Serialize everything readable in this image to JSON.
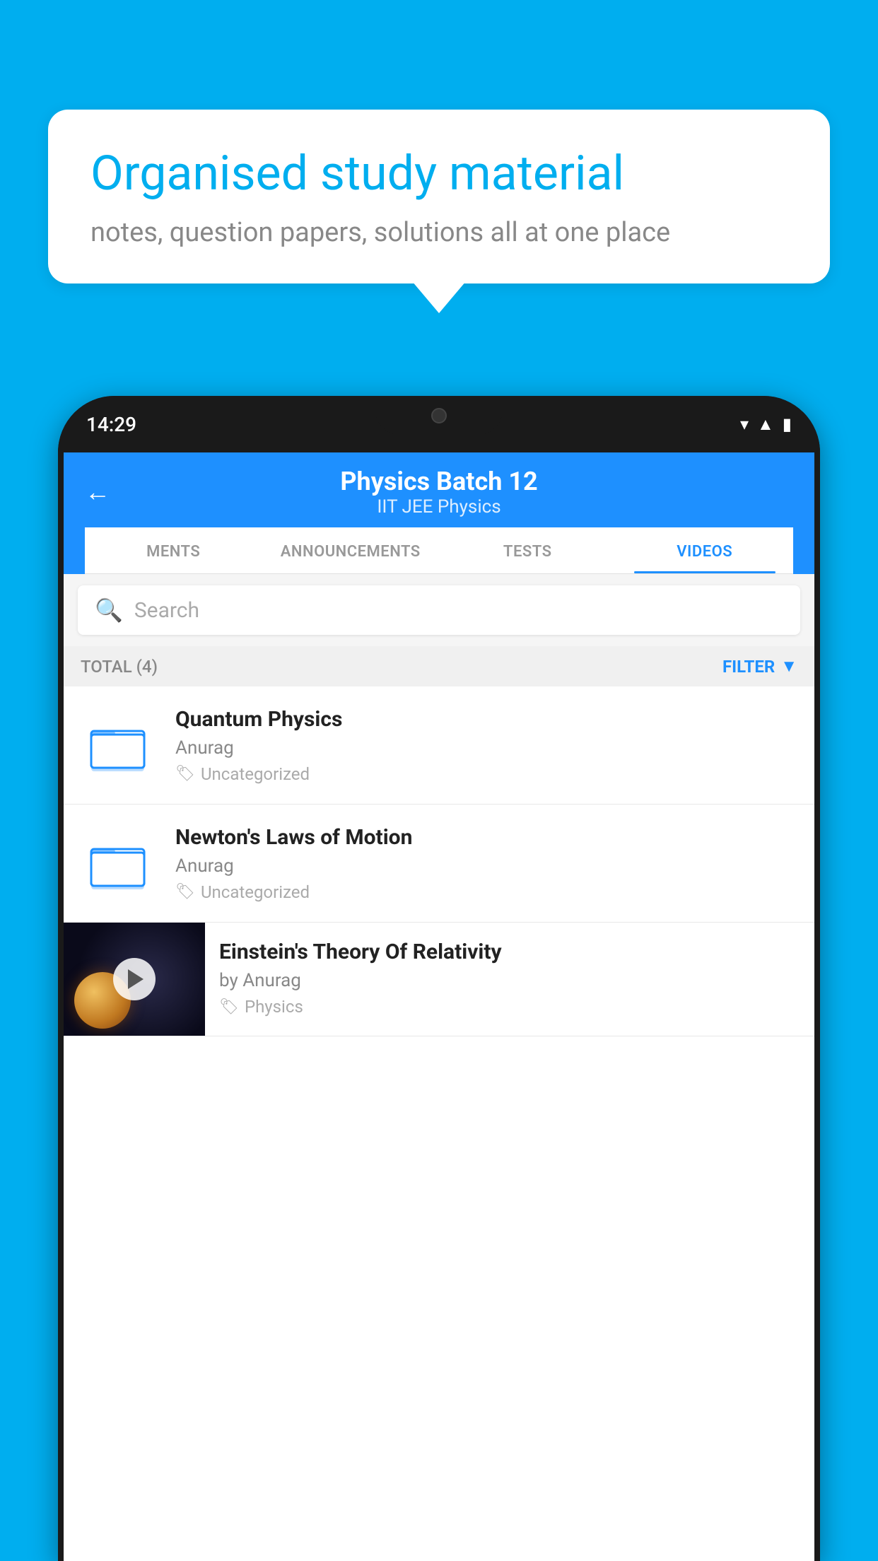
{
  "background_color": "#00AEEF",
  "speech_bubble": {
    "headline": "Organised study material",
    "subtext": "notes, question papers, solutions all at one place"
  },
  "phone": {
    "status_bar": {
      "time": "14:29"
    },
    "header": {
      "title": "Physics Batch 12",
      "subtitle": "IIT JEE   Physics",
      "back_label": "←"
    },
    "tabs": [
      {
        "label": "MENTS",
        "active": false
      },
      {
        "label": "ANNOUNCEMENTS",
        "active": false
      },
      {
        "label": "TESTS",
        "active": false
      },
      {
        "label": "VIDEOS",
        "active": true
      }
    ],
    "search": {
      "placeholder": "Search"
    },
    "total_label": "TOTAL (4)",
    "filter_label": "FILTER",
    "videos": [
      {
        "type": "folder",
        "title": "Quantum Physics",
        "author": "Anurag",
        "tag": "Uncategorized"
      },
      {
        "type": "folder",
        "title": "Newton's Laws of Motion",
        "author": "Anurag",
        "tag": "Uncategorized"
      },
      {
        "type": "thumbnail",
        "title": "Einstein's Theory Of Relativity",
        "author": "by Anurag",
        "tag": "Physics"
      }
    ]
  }
}
